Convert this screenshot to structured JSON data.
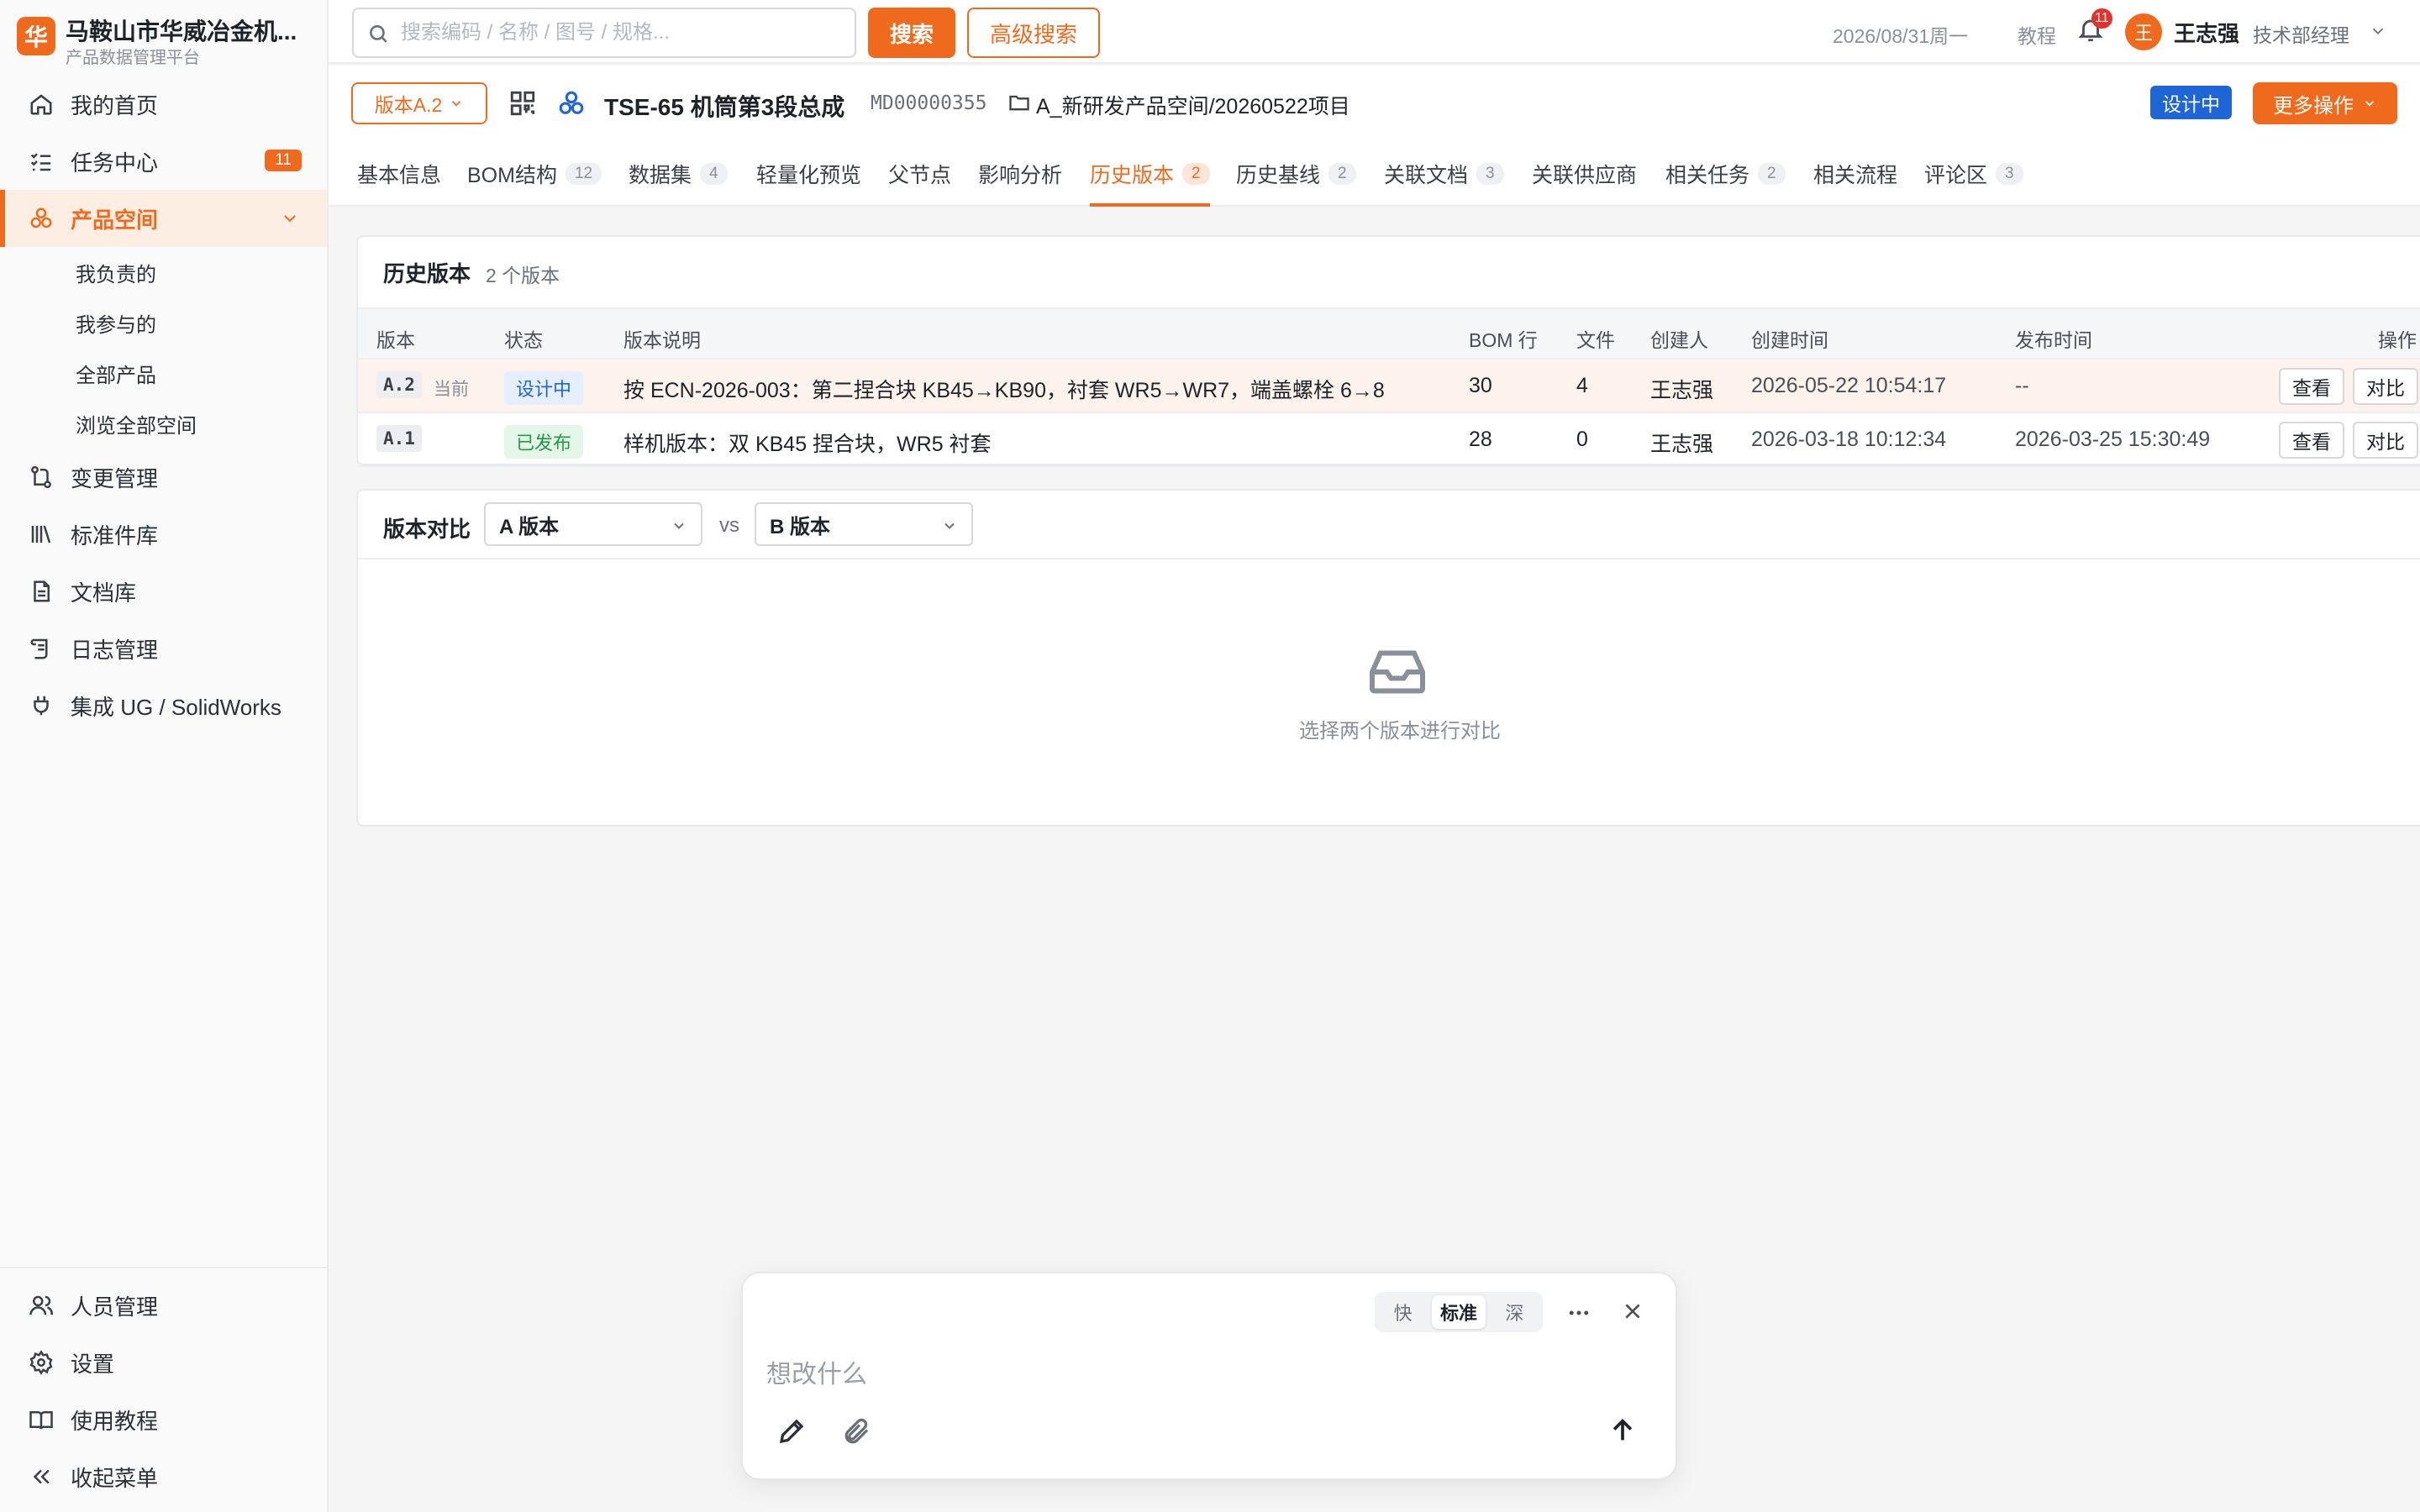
{
  "brand": {
    "logo_char": "华",
    "name": "马鞍山市华威冶金机...",
    "subtitle": "产品数据管理平台"
  },
  "sidebar": {
    "items": [
      {
        "label": "我的首页",
        "icon": "home-icon"
      },
      {
        "label": "任务中心",
        "icon": "tasklist-icon",
        "badge": "11"
      },
      {
        "label": "产品空间",
        "icon": "product-icon",
        "active": true
      },
      {
        "label": "变更管理",
        "icon": "change-icon"
      },
      {
        "label": "标准件库",
        "icon": "library-icon"
      },
      {
        "label": "文档库",
        "icon": "document-icon"
      },
      {
        "label": "日志管理",
        "icon": "log-icon"
      },
      {
        "label": "集成 UG / SolidWorks",
        "icon": "plug-icon"
      }
    ],
    "sub_items": [
      "我负责的",
      "我参与的",
      "全部产品",
      "浏览全部空间"
    ],
    "bottom_items": [
      {
        "label": "人员管理",
        "icon": "users-icon"
      },
      {
        "label": "设置",
        "icon": "gear-icon"
      },
      {
        "label": "使用教程",
        "icon": "book-icon"
      },
      {
        "label": "收起菜单",
        "icon": "collapse-icon"
      }
    ]
  },
  "topbar": {
    "search_placeholder": "搜索编码 / 名称 / 图号 / 规格...",
    "search_label": "搜索",
    "advanced_label": "高级搜索",
    "date": "2026/08/31周一",
    "tutorial": "教程",
    "notif_count": "11",
    "avatar_char": "王",
    "user_name": "王志强",
    "user_role": "技术部经理"
  },
  "product": {
    "version_label": "版本A.2",
    "title": "TSE-65 机筒第3段总成",
    "code": "MD00000355",
    "path": "A_新研发产品空间/20260522项目",
    "status": "设计中",
    "more_label": "更多操作"
  },
  "tabs": [
    {
      "label": "基本信息"
    },
    {
      "label": "BOM结构",
      "count": "12"
    },
    {
      "label": "数据集",
      "count": "4"
    },
    {
      "label": "轻量化预览"
    },
    {
      "label": "父节点"
    },
    {
      "label": "影响分析"
    },
    {
      "label": "历史版本",
      "count": "2",
      "active": true
    },
    {
      "label": "历史基线",
      "count": "2"
    },
    {
      "label": "关联文档",
      "count": "3"
    },
    {
      "label": "关联供应商"
    },
    {
      "label": "相关任务",
      "count": "2"
    },
    {
      "label": "相关流程"
    },
    {
      "label": "评论区",
      "count": "3"
    }
  ],
  "history": {
    "title": "历史版本",
    "subtitle": "2 个版本",
    "columns": [
      "版本",
      "状态",
      "版本说明",
      "BOM 行",
      "文件",
      "创建人",
      "创建时间",
      "发布时间",
      "操作"
    ],
    "rows": [
      {
        "version": "A.2",
        "current_label": "当前",
        "status": "设计中",
        "desc": "按 ECN-2026-003：第二捏合块 KB45→KB90，衬套 WR5→WR7，端盖螺栓 6→8",
        "bom": "30",
        "files": "4",
        "creator": "王志强",
        "created": "2026-05-22 10:54:17",
        "published": "--",
        "view": "查看",
        "compare": "对比"
      },
      {
        "version": "A.1",
        "current_label": "",
        "status": "已发布",
        "desc": "样机版本：双 KB45 捏合块，WR5 衬套",
        "bom": "28",
        "files": "0",
        "creator": "王志强",
        "created": "2026-03-18 10:12:34",
        "published": "2026-03-25 15:30:49",
        "view": "查看",
        "compare": "对比"
      }
    ]
  },
  "compare": {
    "label": "版本对比",
    "a_placeholder": "A 版本",
    "vs": "vs",
    "b_placeholder": "B 版本",
    "empty_text": "选择两个版本进行对比"
  },
  "assistant": {
    "modes": [
      "快",
      "标准",
      "深"
    ],
    "selected_mode": "标准",
    "input_placeholder": "想改什么"
  },
  "colors": {
    "accent": "#f06a1d",
    "blue": "#1e66d6",
    "green": "#239a44"
  }
}
